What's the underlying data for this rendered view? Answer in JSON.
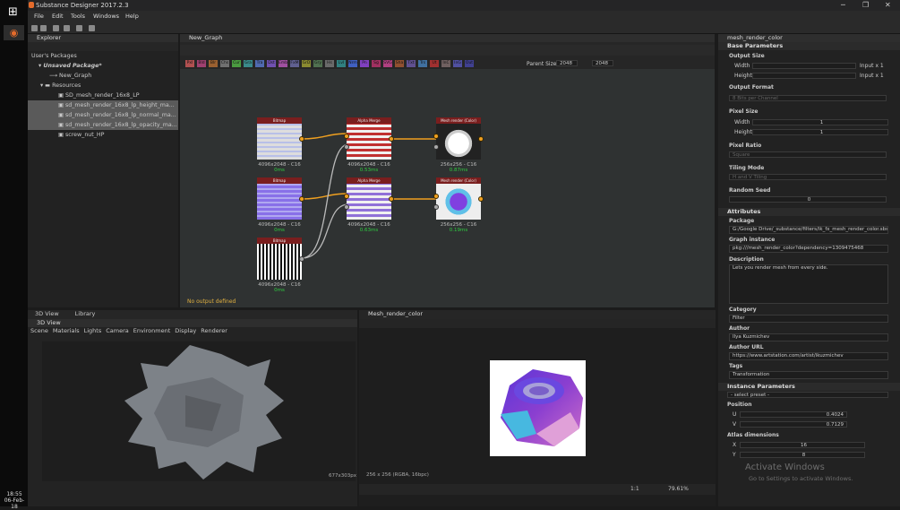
{
  "taskbar": {
    "time": "18:55",
    "date": "06-Feb-18"
  },
  "window": {
    "title": "Substance Designer 2017.2.3"
  },
  "menu": [
    "File",
    "Edit",
    "Tools",
    "Windows",
    "Help"
  ],
  "explorer": {
    "title": "Explorer",
    "root": "User's Packages",
    "package": "Unsaved Package*",
    "graph": "New_Graph",
    "resources": "Resources",
    "files": [
      "SD_mesh_render_16x8_LP",
      "sd_mesh_render_16x8_lp_height_ma...",
      "sd_mesh_render_16x8_lp_normal_ma...",
      "sd_mesh_render_16x8_lp_opacity_ma...",
      "screw_nut_HP"
    ]
  },
  "graph": {
    "tab": "New_Graph",
    "parent_size_label": "Parent Size:",
    "parent_size_a": "2048",
    "parent_size_b": "2048",
    "no_output": "No output defined",
    "chips": [
      "Pxl",
      "Bld",
      "Blr",
      "Chs",
      "Cur",
      "Gra",
      "Tra",
      "Dst",
      "Emb",
      "FxM",
      "GrD",
      "Gry",
      "Hs",
      "Lvl",
      "Nrm",
      "Pn",
      "Sg",
      "SVG",
      "Sha",
      "Txt",
      "Trs",
      "Ut",
      "InC",
      "InG",
      "Out"
    ],
    "nodes": [
      {
        "header": "Bitmap",
        "label": "4096x2048 - C16",
        "time": "0ms"
      },
      {
        "header": "Alpha Merge",
        "label": "4096x2048 - C16",
        "time": "0.53ms"
      },
      {
        "header": "Mesh render (Color)",
        "label": "256x256 - C16",
        "time": "0.87ms"
      },
      {
        "header": "Bitmap",
        "label": "4096x2048 - C16",
        "time": "0ms"
      },
      {
        "header": "Alpha Merge",
        "label": "4096x2048 - C16",
        "time": "0.63ms"
      },
      {
        "header": "Mesh render (Color)",
        "label": "256x256 - C16",
        "time": "0.19ms"
      },
      {
        "header": "Bitmap",
        "label": "4096x2048 - C16",
        "time": "0ms"
      }
    ]
  },
  "view3d": {
    "tab": "3D View",
    "tab2": "Library",
    "title": "3D View",
    "menu": [
      "Scene",
      "Materials",
      "Lights",
      "Camera",
      "Environment",
      "Display",
      "Renderer"
    ],
    "res": "677x303px"
  },
  "view2d": {
    "title": "Mesh_render_color",
    "info": "256 x 256 (RGBA, 16bpc)",
    "ratio": "1:1",
    "zoom": "79.61%"
  },
  "props": {
    "title": "mesh_render_color",
    "base_params": "Base Parameters",
    "output_size": "Output Size",
    "width": "Width",
    "height": "Height",
    "input_w": "Input x 1",
    "input_h": "Input x 1",
    "output_format": "Output Format",
    "output_format_val": "8 Bits per Channel",
    "pixel_size": "Pixel Size",
    "ps_width_val": "1",
    "ps_height_val": "1",
    "pixel_ratio": "Pixel Ratio",
    "pixel_ratio_val": "Square",
    "tiling_mode": "Tiling Mode",
    "tiling_mode_val": "H and V Tiling",
    "random_seed": "Random Seed",
    "random_seed_val": "0",
    "attributes": "Attributes",
    "package": "Package",
    "package_val": "G:/Google Drive/_substance/filters/ik_fx_mesh_render_color.sbs",
    "graph_instance": "Graph instance",
    "graph_instance_val": "pkg:///mesh_render_color?dependency=1309475468",
    "description": "Description",
    "description_val": "Lets you render mesh from every side.",
    "category": "Category",
    "category_val": "Filter",
    "author": "Author",
    "author_val": "Ilya Kuzmichev",
    "author_url": "Author URL",
    "author_url_val": "https://www.artstation.com/artist/ikuzmichev",
    "tags": "Tags",
    "tags_val": "Transformation",
    "instance_params": "Instance Parameters",
    "preset": "- select preset -",
    "position": "Position",
    "u": "U",
    "u_val": "0.4024",
    "v": "V",
    "v_val": "0.7129",
    "atlas": "Atlas dimensions",
    "atlas_x": "X",
    "atlas_y": "Y",
    "atlas_x_val": "16",
    "atlas_y_val": "8",
    "watermark1": "Activate Windows",
    "watermark2": "Go to Settings to activate Windows."
  }
}
